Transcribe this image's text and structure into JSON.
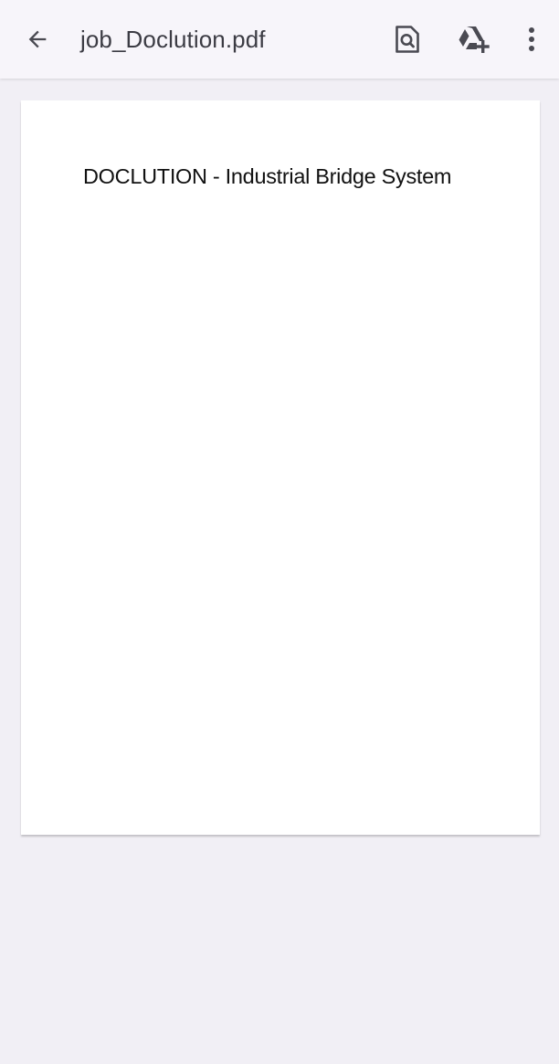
{
  "toolbar": {
    "title": "job_Doclution.pdf",
    "back_icon": "arrow-back-icon",
    "search_icon": "find-in-page-icon",
    "drive_icon": "add-to-drive-icon",
    "more_icon": "more-vert-icon"
  },
  "document": {
    "page_1": {
      "heading": "DOCLUTION - Industrial Bridge System"
    }
  },
  "colors": {
    "toolbar_bg": "#f7f5fa",
    "viewer_bg": "#f1eff5",
    "page_bg": "#ffffff",
    "icon": "#4a4a52"
  }
}
